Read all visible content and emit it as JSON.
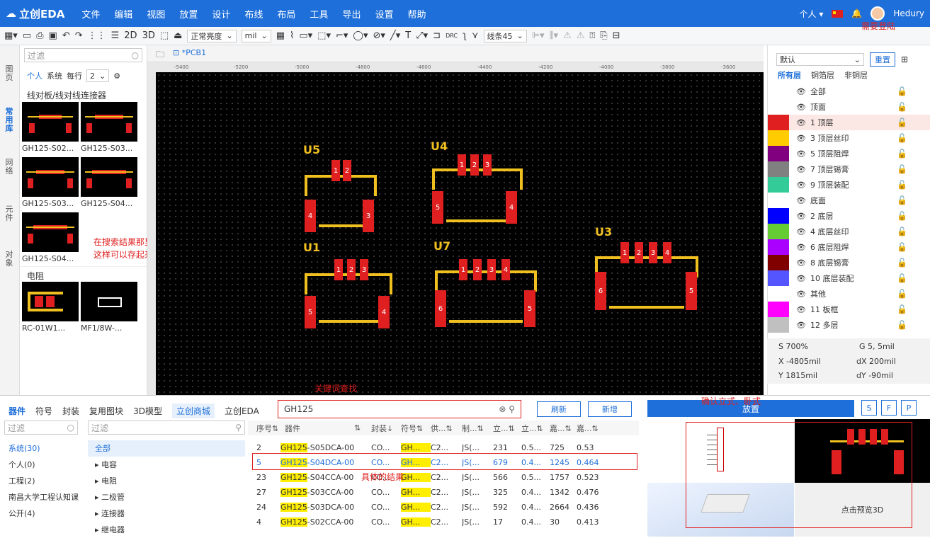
{
  "app": {
    "logo": "立创EDA",
    "menus": [
      "文件",
      "编辑",
      "视图",
      "放置",
      "设计",
      "布线",
      "布局",
      "工具",
      "导出",
      "设置",
      "帮助"
    ],
    "personal": "个人",
    "user": "Hedury"
  },
  "toolbar": {
    "view2d": "2D",
    "view3d": "3D",
    "brightness": "正常亮度",
    "unit": "mil",
    "linetype": "线条45",
    "drc": "DRC"
  },
  "rail": {
    "pages": "图页",
    "common": "常用库",
    "net": "网络",
    "parts": "元件",
    "objects": "对象"
  },
  "lib": {
    "filter": "过滤",
    "personal": "个人",
    "system": "系统",
    "perrow": "每行",
    "rows": "2",
    "section": "线对板/线对线连接器",
    "items": [
      "GH125-S02...",
      "GH125-S03...",
      "GH125-S03...",
      "GH125-S04...",
      "GH125-S04..."
    ],
    "section2": "电阻",
    "items2": [
      "RC-01W1...",
      "MF1/8W-..."
    ]
  },
  "tab": {
    "name": "*PCB1"
  },
  "ruler": [
    "-5400",
    "-5200",
    "-5000",
    "-4800",
    "-4600",
    "-4400",
    "-4200",
    "-4000",
    "-3800",
    "-3600"
  ],
  "designators": [
    "U5",
    "U4",
    "U1",
    "U7",
    "U3"
  ],
  "annotations": {
    "right_click": "在搜索结果那里可以右键，加入常用库",
    "save": "这样可以存起来，然后一起放置",
    "keyword": "关键词查找",
    "result": "具体的结果",
    "confirm": "确认立式、卧式",
    "login": "需要登陆"
  },
  "layers": {
    "preset": "默认",
    "reset": "重置",
    "tabs": [
      "所有层",
      "铜箔层",
      "非铜层"
    ],
    "items": [
      {
        "n": "全部",
        "c": ""
      },
      {
        "n": "顶面",
        "c": ""
      },
      {
        "n": "1 顶层",
        "c": "#e02020"
      },
      {
        "n": "3 顶层丝印",
        "c": "#ffcc00"
      },
      {
        "n": "5 顶层阻焊",
        "c": "#800080"
      },
      {
        "n": "7 顶层锡膏",
        "c": "#808080"
      },
      {
        "n": "9 顶层装配",
        "c": "#33cc99"
      },
      {
        "n": "底面",
        "c": ""
      },
      {
        "n": "2 底层",
        "c": "#0000ff"
      },
      {
        "n": "4 底层丝印",
        "c": "#66cc33"
      },
      {
        "n": "6 底层阻焊",
        "c": "#aa00ff"
      },
      {
        "n": "8 底层锡膏",
        "c": "#800000"
      },
      {
        "n": "10 底层装配",
        "c": "#5555ff"
      },
      {
        "n": "其他",
        "c": ""
      },
      {
        "n": "11 板框",
        "c": "#ff00ff"
      },
      {
        "n": "12 多层",
        "c": "#c0c0c0"
      }
    ]
  },
  "status": {
    "s": "S 700%",
    "g": "G 5, 5mil",
    "x": "X -4805mil",
    "dx": "dX 200mil",
    "y": "Y 1815mil",
    "dy": "dY -90mil"
  },
  "bottom": {
    "tabs": [
      "器件",
      "符号",
      "封装",
      "复用图块",
      "3D模型",
      "立创商城",
      "立创EDA"
    ],
    "search": "GH125",
    "refresh": "刷新",
    "add": "新增",
    "place": "放置",
    "preview3d": "点击预览3D",
    "sfp": [
      "S",
      "F",
      "P"
    ],
    "cats": [
      "系统(30)",
      "个人(0)",
      "工程(2)",
      "南昌大学工程认知课",
      "公开(4)"
    ],
    "tree": [
      "全部",
      "▸ 电容",
      "▸ 电阻",
      "▸ 二极管",
      "▸ 连接器",
      "▸ 继电器"
    ],
    "headers": [
      "序号⇅",
      "器件",
      "⇅",
      "封装↓",
      "符号⇅",
      "供...⇅",
      "制...⇅",
      "立...⇅",
      "立...⇅",
      "嘉...⇅",
      "嘉...⇅"
    ],
    "rows": [
      [
        "2",
        "GH125-S05DCA-00",
        "CO...",
        "GH...",
        "C2...",
        "JS(...",
        "231",
        "0.5...",
        "725",
        "0.53"
      ],
      [
        "5",
        "GH125-S04DCA-00",
        "CO...",
        "GH...",
        "C2...",
        "JS(...",
        "679",
        "0.4...",
        "1245",
        "0.464"
      ],
      [
        "23",
        "GH125-S04CCA-00",
        "CO...",
        "GH...",
        "C2...",
        "JS(...",
        "566",
        "0.5...",
        "1757",
        "0.523"
      ],
      [
        "27",
        "GH125-S03CCA-00",
        "CO...",
        "GH...",
        "C2...",
        "JS(...",
        "325",
        "0.4...",
        "1342",
        "0.476"
      ],
      [
        "24",
        "GH125-S03DCA-00",
        "CO...",
        "GH...",
        "C2...",
        "JS(...",
        "592",
        "0.4...",
        "2664",
        "0.436"
      ],
      [
        "4",
        "GH125-S02CCA-00",
        "CO...",
        "GH...",
        "C2...",
        "JS(...",
        "17",
        "0.4...",
        "30",
        "0.413"
      ]
    ]
  }
}
